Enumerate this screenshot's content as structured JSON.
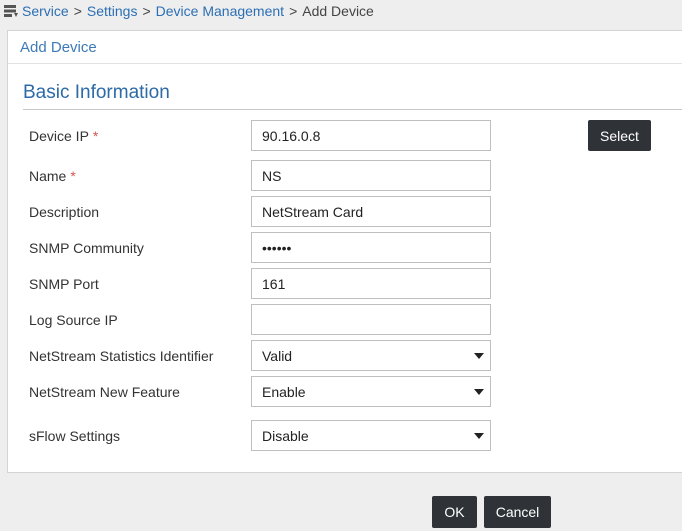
{
  "breadcrumb": {
    "items": [
      "Service",
      "Settings",
      "Device Management"
    ],
    "separator": ">",
    "current": "Add Device"
  },
  "panel": {
    "title": "Add Device"
  },
  "section": {
    "title": "Basic Information"
  },
  "form": {
    "device_ip": {
      "label": "Device IP",
      "required": "*",
      "value": "90.16.0.8"
    },
    "name": {
      "label": "Name",
      "required": "*",
      "value": "NS"
    },
    "description": {
      "label": "Description",
      "value": "NetStream Card"
    },
    "snmp_community": {
      "label": "SNMP Community",
      "value": "••••••"
    },
    "snmp_port": {
      "label": "SNMP Port",
      "value": "161"
    },
    "log_source_ip": {
      "label": "Log Source IP",
      "value": ""
    },
    "netstream_stats_id": {
      "label": "NetStream Statistics Identifier",
      "value": "Valid"
    },
    "netstream_new_feature": {
      "label": "NetStream New Feature",
      "value": "Enable"
    },
    "sflow_settings": {
      "label": "sFlow Settings",
      "value": "Disable"
    }
  },
  "buttons": {
    "select": "Select",
    "ok": "OK",
    "cancel": "Cancel"
  },
  "icons": {
    "breadcrumb": "service-menu-icon"
  },
  "colors": {
    "link": "#2c6fb4",
    "header": "#3d7ab8",
    "required": "#d9534f",
    "button": "#2f3237"
  }
}
